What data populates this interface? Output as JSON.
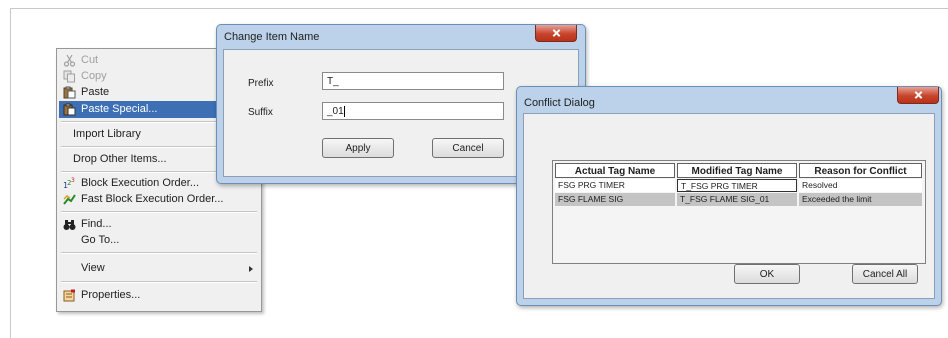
{
  "context_menu": {
    "items": [
      {
        "label": "Cut",
        "icon": "scissors-icon",
        "state": "disabled"
      },
      {
        "label": "Copy",
        "icon": "copy-icon",
        "state": "disabled"
      },
      {
        "label": "Paste",
        "icon": "paste-icon",
        "state": "normal"
      },
      {
        "label": "Paste Special...",
        "icon": "paste-special-icon",
        "state": "selected"
      },
      {
        "label": "Import Library",
        "icon": "",
        "state": "normal"
      },
      {
        "label": "Drop Other Items...",
        "icon": "",
        "state": "normal"
      },
      {
        "label": "Block Execution Order...",
        "icon": "execution-order-icon",
        "state": "normal"
      },
      {
        "label": "Fast Block Execution Order...",
        "icon": "fast-execution-order-icon",
        "state": "normal"
      },
      {
        "label": "Find...",
        "icon": "binoculars-icon",
        "state": "normal"
      },
      {
        "label": "Go To...",
        "icon": "",
        "state": "normal"
      },
      {
        "label": "View",
        "icon": "",
        "state": "normal",
        "submenu": true
      },
      {
        "label": "Properties...",
        "icon": "properties-icon",
        "state": "normal"
      }
    ]
  },
  "change_item_dialog": {
    "title": "Change Item Name",
    "prefix_label": "Prefix",
    "prefix_value": "T_",
    "suffix_label": "Suffix",
    "suffix_value": "_01",
    "apply_label": "Apply",
    "cancel_label": "Cancel"
  },
  "conflict_dialog": {
    "title": "Conflict Dialog",
    "columns": [
      "Actual Tag Name",
      "Modified Tag Name",
      "Reason for Conflict"
    ],
    "rows": [
      [
        "FSG PRG TIMER",
        "T_FSG PRG TIMER",
        "Resolved"
      ],
      [
        "FSG FLAME SIG",
        "T_FSG FLAME SIG_01",
        "Exceeded the limit"
      ]
    ],
    "ok_label": "OK",
    "cancel_all_label": "Cancel All"
  },
  "colors": {
    "selection": "#3d6fb4",
    "close_button": "#c7452d",
    "window_frame": "#bcd2ea"
  }
}
